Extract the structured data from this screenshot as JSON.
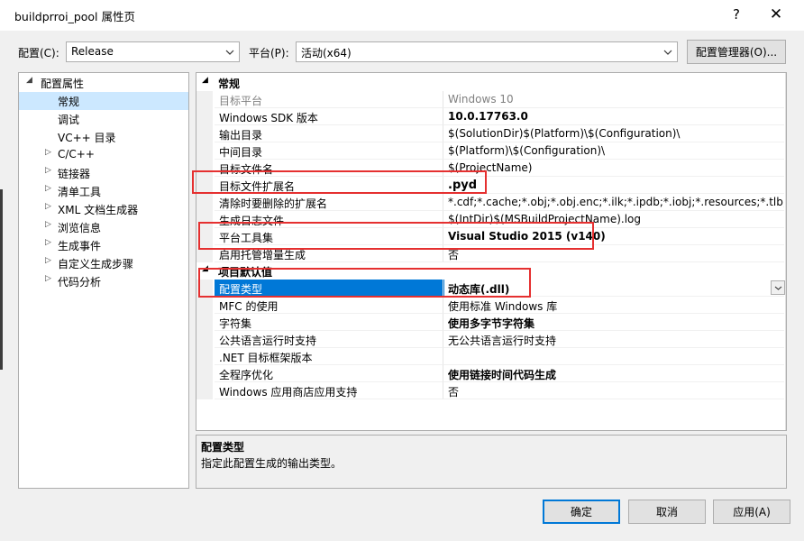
{
  "window": {
    "title": "buildprroi_pool 属性页",
    "help_label": "?",
    "close_label": "✕"
  },
  "toolbar": {
    "config_label": "配置(C):",
    "config_value": "Release",
    "platform_label": "平台(P):",
    "platform_value": "活动(x64)",
    "config_manager_label": "配置管理器(O)..."
  },
  "tree": {
    "items": [
      {
        "label": "配置属性",
        "expander": "◢"
      },
      {
        "label": "常规",
        "expander": ""
      },
      {
        "label": "调试",
        "expander": ""
      },
      {
        "label": "VC++ 目录",
        "expander": ""
      },
      {
        "label": "C/C++",
        "expander": "▷"
      },
      {
        "label": "链接器",
        "expander": "▷"
      },
      {
        "label": "清单工具",
        "expander": "▷"
      },
      {
        "label": "XML 文档生成器",
        "expander": "▷"
      },
      {
        "label": "浏览信息",
        "expander": "▷"
      },
      {
        "label": "生成事件",
        "expander": "▷"
      },
      {
        "label": "自定义生成步骤",
        "expander": "▷"
      },
      {
        "label": "代码分析",
        "expander": "▷"
      }
    ]
  },
  "grid": {
    "sections": [
      {
        "title": "常规",
        "expander": "◢"
      },
      {
        "title": "项目默认值",
        "expander": "◢"
      }
    ],
    "general_rows": [
      {
        "name": "目标平台",
        "value": "Windows 10"
      },
      {
        "name": "Windows SDK 版本",
        "value": "10.0.17763.0"
      },
      {
        "name": "输出目录",
        "value": "$(SolutionDir)$(Platform)\\$(Configuration)\\"
      },
      {
        "name": "中间目录",
        "value": "$(Platform)\\$(Configuration)\\"
      },
      {
        "name": "目标文件名",
        "value": "$(ProjectName)"
      },
      {
        "name": "目标文件扩展名",
        "value": ".pyd"
      },
      {
        "name": "清除时要删除的扩展名",
        "value": "*.cdf;*.cache;*.obj;*.obj.enc;*.ilk;*.ipdb;*.iobj;*.resources;*.tlb;*.tli;*.t"
      },
      {
        "name": "生成日志文件",
        "value": "$(IntDir)$(MSBuildProjectName).log"
      },
      {
        "name": "平台工具集",
        "value": "Visual Studio 2015 (v140)"
      },
      {
        "name": "启用托管增量生成",
        "value": "否"
      }
    ],
    "default_rows": [
      {
        "name": "配置类型",
        "value": "动态库(.dll)"
      },
      {
        "name": "MFC 的使用",
        "value": "使用标准 Windows 库"
      },
      {
        "name": "字符集",
        "value": "使用多字节字符集"
      },
      {
        "name": "公共语言运行时支持",
        "value": "无公共语言运行时支持"
      },
      {
        "name": ".NET 目标框架版本",
        "value": ""
      },
      {
        "name": "全程序优化",
        "value": "使用链接时间代码生成"
      },
      {
        "name": "Windows 应用商店应用支持",
        "value": "否"
      }
    ]
  },
  "description": {
    "title": "配置类型",
    "text": "指定此配置生成的输出类型。"
  },
  "buttons": {
    "ok": "确定",
    "cancel": "取消",
    "apply": "应用(A)"
  },
  "colors": {
    "selection": "#0078d7",
    "tree_selection": "#cce8ff",
    "highlight_box": "#e53030"
  },
  "icons": {
    "dropdown": "chevron-down-icon",
    "collapsed": "triangle-right-icon",
    "expanded": "triangle-down-icon"
  }
}
